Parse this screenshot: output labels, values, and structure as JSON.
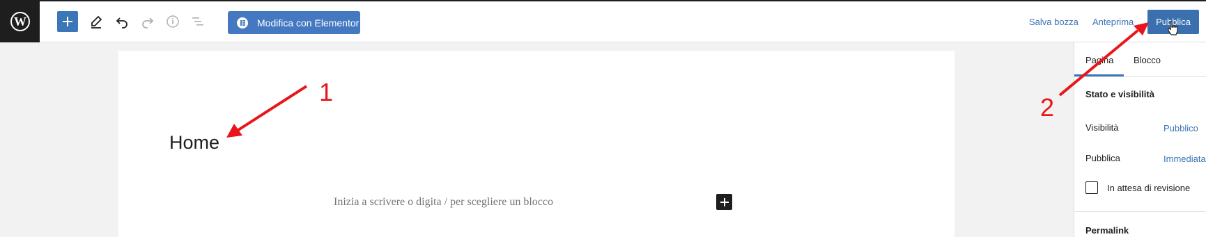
{
  "toolbar": {
    "elementor_label": "Modifica con Elementor",
    "save_draft": "Salva bozza",
    "preview": "Anteprima",
    "publish": "Pubblica",
    "icons": [
      "wordpress-logo",
      "plus",
      "pencil",
      "undo",
      "redo",
      "info",
      "list-view"
    ]
  },
  "editor": {
    "title": "Home",
    "placeholder": "Inizia a scrivere o digita / per scegliere un blocco"
  },
  "sidebar": {
    "tabs": [
      "Pagina",
      "Blocco"
    ],
    "active_tab": "Pagina",
    "status_section": "Stato e visibilità",
    "visibility_label": "Visibilità",
    "visibility_value": "Pubblico",
    "publish_label": "Pubblica",
    "publish_value": "Immediatamente",
    "pending_review": "In attesa di revisione",
    "permalink_section": "Permalink"
  },
  "annotations": {
    "marker_1": "1",
    "marker_2": "2",
    "color": "#e8161b"
  },
  "colors": {
    "accent": "#3a76b8",
    "link": "#3c73b6",
    "dark": "#1e1e1e"
  }
}
